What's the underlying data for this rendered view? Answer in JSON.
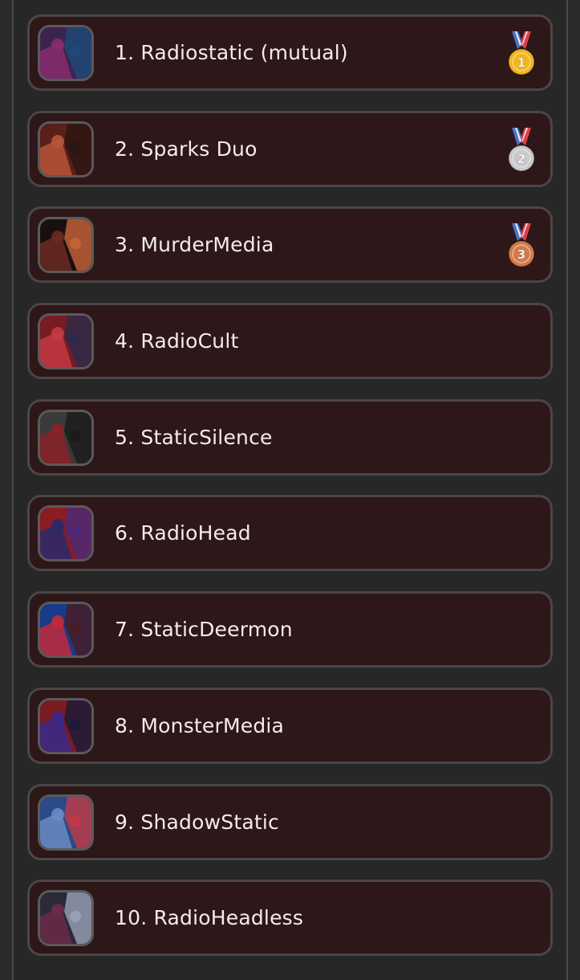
{
  "leaderboard": {
    "items": [
      {
        "label": "1.  Radiostatic (mutual)",
        "medal": "gold-medal-icon",
        "medal_number": "1",
        "avatar_colors": [
          "#3b2550",
          "#8a2c6e",
          "#1f4a78"
        ]
      },
      {
        "label": "2.  Sparks Duo",
        "medal": "silver-medal-icon",
        "medal_number": "2",
        "avatar_colors": [
          "#5a1f18",
          "#b8553a",
          "#2a1412"
        ]
      },
      {
        "label": "3.  MurderMedia",
        "medal": "bronze-medal-icon",
        "medal_number": "3",
        "avatar_colors": [
          "#1a0f10",
          "#6a2a22",
          "#c8643a"
        ]
      },
      {
        "label": "4.  RadioCult",
        "medal": null,
        "avatar_colors": [
          "#7a1a22",
          "#c23a44",
          "#2c2a4a"
        ]
      },
      {
        "label": "5.  StaticSilence",
        "medal": null,
        "avatar_colors": [
          "#3a3a3a",
          "#8a2228",
          "#1a1a1a"
        ]
      },
      {
        "label": "6.  RadioHead",
        "medal": null,
        "avatar_colors": [
          "#8a1c22",
          "#2a2a6a",
          "#4a2a7a"
        ]
      },
      {
        "label": "7.  StaticDeermon",
        "medal": null,
        "avatar_colors": [
          "#1a3a8a",
          "#c22a3a",
          "#4a1a20"
        ]
      },
      {
        "label": "8.  MonsterMedia",
        "medal": null,
        "avatar_colors": [
          "#7a1a22",
          "#3a2a8a",
          "#1a1a3a"
        ]
      },
      {
        "label": "9.  ShadowStatic",
        "medal": null,
        "avatar_colors": [
          "#2a4a8a",
          "#6a8ac2",
          "#c23a44"
        ]
      },
      {
        "label": "10.  RadioHeadless",
        "medal": null,
        "avatar_colors": [
          "#2a2a3a",
          "#6a2a4a",
          "#9aa2b8"
        ]
      }
    ]
  },
  "colors": {
    "item_background": "#2d1719",
    "item_border": "#4c4646",
    "text": "#f4ecec",
    "gold": "#f2b51e",
    "silver": "#c9c9c9",
    "bronze": "#d17a4a",
    "ribbon_blue": "#4a72c8",
    "ribbon_red": "#d8404a"
  }
}
